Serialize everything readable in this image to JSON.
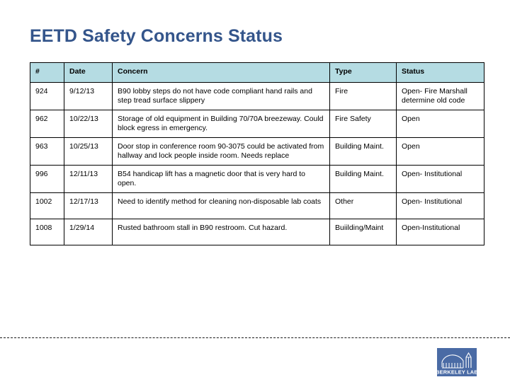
{
  "slide": {
    "title": "EETD Safety Concerns Status",
    "title_color": "#34558b",
    "background_color": "#ffffff"
  },
  "table": {
    "header_background": "#b5dce3",
    "border_color": "#000000",
    "columns": [
      {
        "key": "num",
        "label": "#"
      },
      {
        "key": "date",
        "label": "Date"
      },
      {
        "key": "concern",
        "label": "Concern"
      },
      {
        "key": "type",
        "label": "Type"
      },
      {
        "key": "status",
        "label": "Status"
      }
    ],
    "rows": [
      {
        "num": "924",
        "date": "9/12/13",
        "concern": "B90 lobby steps do not have code compliant hand rails and step tread surface slippery",
        "type": "Fire",
        "status": "Open- Fire Marshall determine old code"
      },
      {
        "num": "962",
        "date": "10/22/13",
        "concern": "Storage of old equipment in Building 70/70A breezeway. Could block egress in emergency.",
        "type": "Fire Safety",
        "status": "Open"
      },
      {
        "num": "963",
        "date": "10/25/13",
        "concern": "Door stop in conference room 90-3075 could be activated from hallway and lock people inside room. Needs replace",
        "type": "Building Maint.",
        "status": "Open"
      },
      {
        "num": "996",
        "date": "12/11/13",
        "concern": "B54 handicap lift has a magnetic door that is very hard to open.",
        "type": "Building Maint.",
        "status": "Open- Institutional"
      },
      {
        "num": "1002",
        "date": "12/17/13",
        "concern": "Need to identify method for cleaning non-disposable lab coats",
        "type": "Other",
        "status": "Open- Institutional"
      },
      {
        "num": "1008",
        "date": "1/29/14",
        "concern": "Rusted bathroom stall in B90 restroom. Cut hazard.",
        "type": "Buiilding/Maint",
        "status": "Open-Institutional"
      }
    ]
  },
  "footer": {
    "logo_text": "BERKELEY LAB",
    "logo_background": "#4a6ba5"
  }
}
